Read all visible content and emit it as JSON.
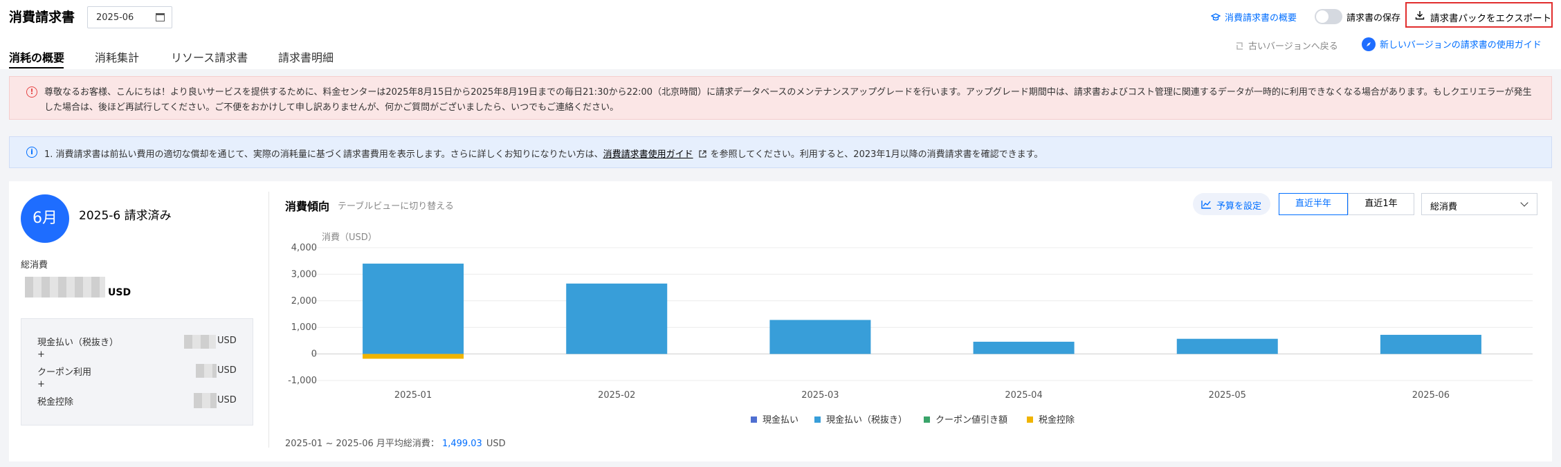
{
  "header": {
    "title": "消費請求書",
    "month": "2025-06",
    "overview_link": "消費請求書の概要",
    "save_toggle_label": "請求書の保存",
    "export_label": "請求書パックをエクスポート",
    "old_version": "古いバージョンへ戻る",
    "new_version_guide": "新しいバージョンの請求書の使用ガイド"
  },
  "tabs": [
    "消耗の概要",
    "消耗集計",
    "リソース請求書",
    "請求書明細"
  ],
  "banners": {
    "error": "尊敬なるお客様、こんにちは！より良いサービスを提供するために、料金センターは2025年8月15日から2025年8月19日までの毎日21:30から22:00（北京時間）に請求データベースのメンテナンスアップグレードを行います。アップグレード期間中は、請求書およびコスト管理に関連するデータが一時的に利用できなくなる場合があります。もしクエリエラーが発生した場合は、後ほど再試行してください。ご不便をおかけして申し訳ありませんが、何かご質問がございましたら、いつでもご連絡ください。",
    "info_before": "1. 消費請求書は前払い費用の適切な償却を通じて、実際の消耗量に基づく請求書費用を表示します。さらに詳しくお知りになりたい方は、",
    "info_link": "消費請求書使用ガイド",
    "info_after": "を参照してください。利用すると、2023年1月以降の消費請求書を確認できます。"
  },
  "summary": {
    "month_badge": "6月",
    "status": "2025-6 請求済み",
    "total_label": "総消費",
    "currency": "USD",
    "breakdown": [
      {
        "label": "現金払い（税抜き）",
        "unit": "USD"
      },
      {
        "op": "+"
      },
      {
        "label": "クーポン利用",
        "unit": "USD"
      },
      {
        "op": "+"
      },
      {
        "label": "税金控除",
        "unit": "USD"
      }
    ]
  },
  "chart_header": {
    "title": "消費傾向",
    "switch_view": "テーブルビューに切り替える",
    "budget_btn": "予算を設定",
    "range_half": "直近半年",
    "range_year": "直近1年",
    "metric_select": "総消費"
  },
  "chart_data": {
    "type": "bar",
    "ylabel": "消費（USD）",
    "ylim": [
      -1000,
      4000
    ],
    "yticks": [
      4000,
      3000,
      2000,
      1000,
      0,
      -1000
    ],
    "ytick_labels": [
      "4,000",
      "3,000",
      "2,000",
      "1,000",
      "0",
      "-1,000"
    ],
    "categories": [
      "2025-01",
      "2025-02",
      "2025-03",
      "2025-04",
      "2025-05",
      "2025-06"
    ],
    "series": [
      {
        "name": "現金払い",
        "color": "#4f6fd1",
        "values": [
          0,
          0,
          0,
          0,
          0,
          0
        ]
      },
      {
        "name": "現金払い（税抜き）",
        "color": "#389ed9",
        "values": [
          3400,
          2650,
          1280,
          460,
          570,
          720
        ]
      },
      {
        "name": "クーポン値引き額",
        "color": "#3aa46a",
        "values": [
          0,
          0,
          0,
          0,
          0,
          0
        ]
      },
      {
        "name": "税金控除",
        "color": "#f0b400",
        "values": [
          -180,
          0,
          0,
          0,
          0,
          0
        ]
      }
    ],
    "grid": true,
    "legend": "bottom"
  },
  "footer": {
    "avg_label": "2025-01 ~ 2025-06 月平均総消費：",
    "avg_value": "1,499.03",
    "currency": "USD"
  }
}
